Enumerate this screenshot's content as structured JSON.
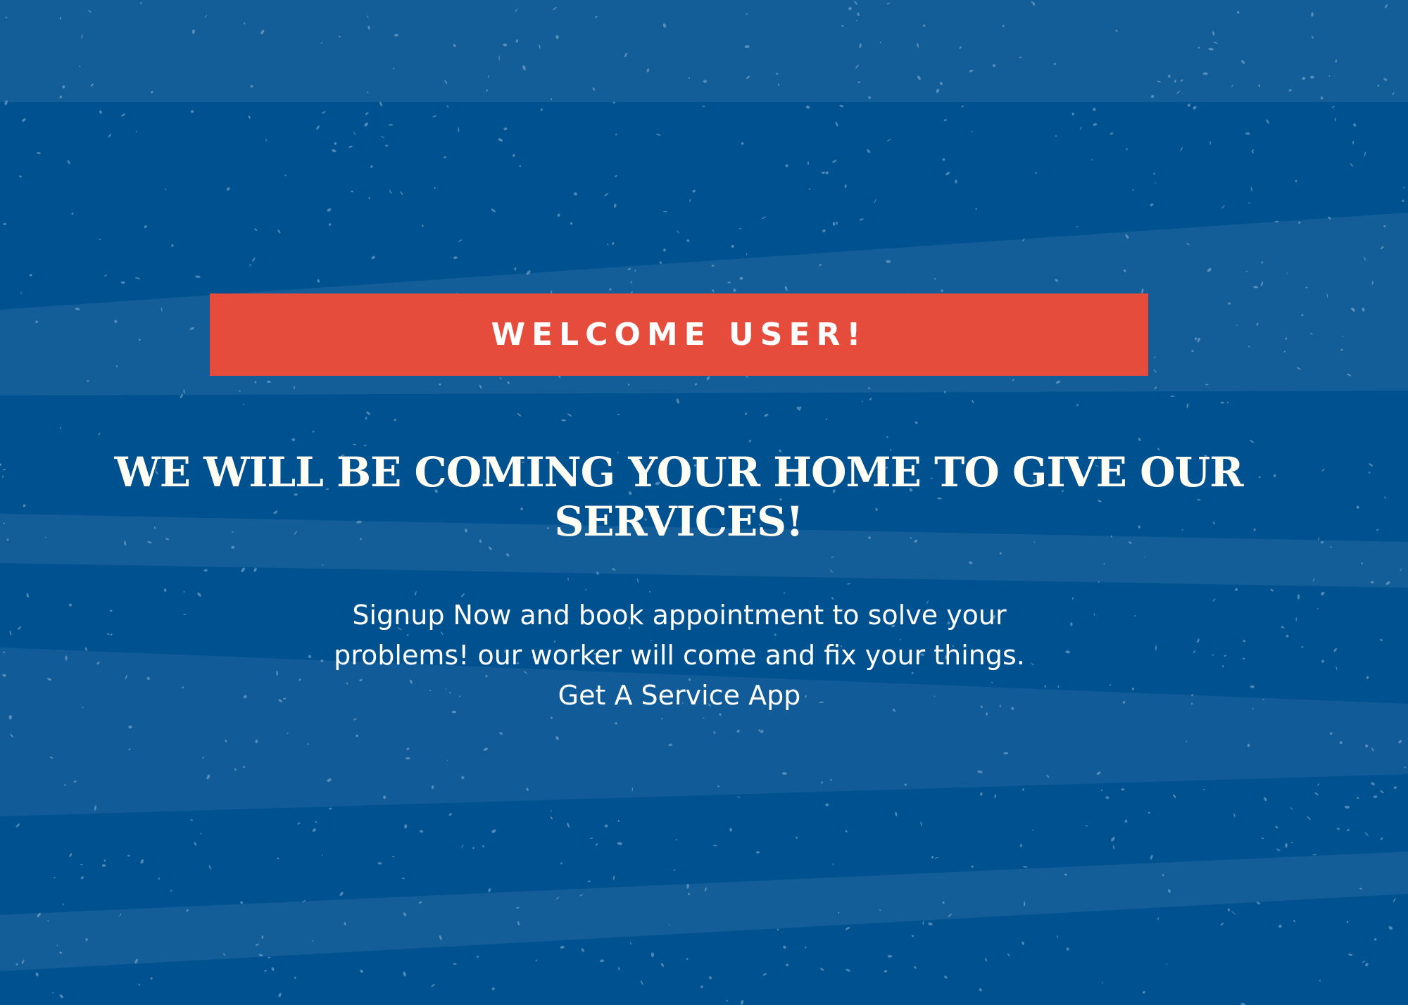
{
  "welcome": {
    "label": "WELCOME USER!"
  },
  "headline": {
    "line1": "WE WILL BE COMING YOUR HOME TO GIVE OUR",
    "line2": "SERVICES!"
  },
  "description": {
    "line1": "Signup Now and book appointment to solve your",
    "line2": "problems! our worker will come and fix your things.",
    "line3": "Get A Service App"
  },
  "colors": {
    "background": "#00518f",
    "stripe": "#2a6fa5",
    "banner": "#e64c3c",
    "text": "#ffffff",
    "headline_text": "#fffdf4"
  }
}
